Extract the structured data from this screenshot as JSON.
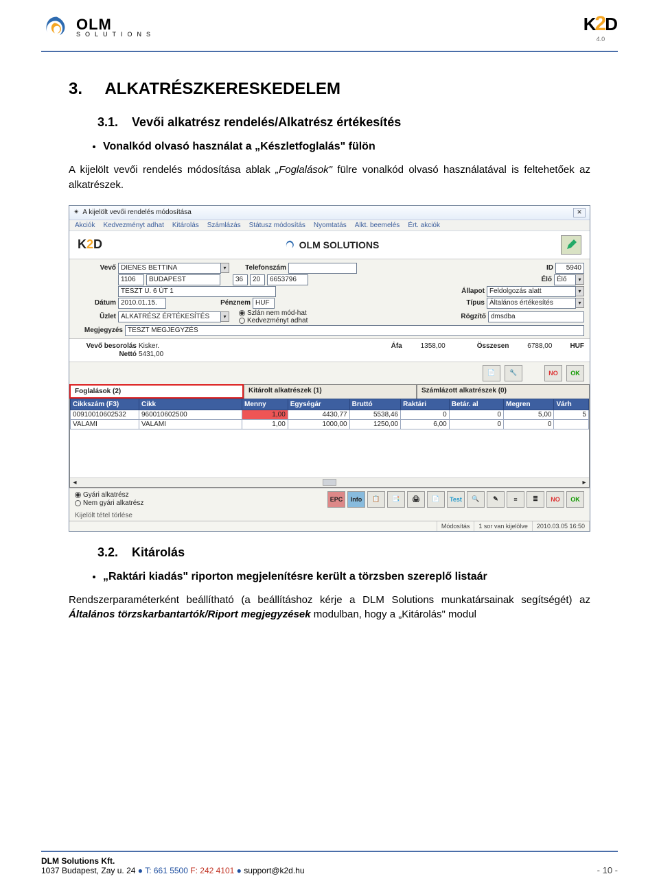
{
  "header": {
    "left_logo_text": "OLM",
    "left_logo_sub": "SOLUTIONS",
    "right_logo_text_k": "K",
    "right_logo_text_num": "2",
    "right_logo_text_d": "D",
    "right_logo_sub": "4.0"
  },
  "doc": {
    "h1_num": "3.",
    "h1_text": "ALKATRÉSZKERESKEDELEM",
    "h2a_num": "3.1.",
    "h2a_text": "Vevői alkatrész rendelés/Alkatrész értékesítés",
    "bullet_a": "Vonalkód olvasó használat a „Készletfoglalás\" fülön",
    "para_a_pre": "A kijelölt vevői rendelés módosítása ablak ",
    "para_a_ital": "„Foglalások\"",
    "para_a_post": " fülre vonalkód olvasó használatával is feltehetőek az alkatrészek.",
    "h2b_num": "3.2.",
    "h2b_text": "Kitárolás",
    "bullet_b": "„Raktári kiadás\" riporton megjelenítésre került a törzsben szereplő listaár",
    "para_b_pre": "Rendszerparaméterként beállítható (a beállításhoz kérje a DLM Solutions munkatársainak segítségét) az ",
    "para_b_ital": "Általános törzskarbantartók/Riport megjegyzések",
    "para_b_post": " modulban, hogy a „Kitárolás\" modul"
  },
  "win": {
    "title": "A kijelölt vevői rendelés módosítása",
    "close": "✕",
    "menu": [
      "Akciók",
      "Kedvezményt adhat",
      "Kitárolás",
      "Számlázás",
      "Státusz módosítás",
      "Nyomtatás",
      "Alkt. beemelés",
      "Ért. akciók"
    ],
    "form": {
      "vevo_label": "Vevő",
      "vevo": "DIENES BETTINA",
      "tel_label": "Telefonszám",
      "id_label": "ID",
      "id": "5940",
      "zip": "1106",
      "city": "BUDAPEST",
      "a": "36",
      "b": "20",
      "phone": "6653796",
      "elo_label": "Élő",
      "elo": "Élő",
      "addr": "TESZT U. 6 ÚT 1",
      "allapot_label": "Állapot",
      "allapot": "Feldolgozás alatt",
      "datum_label": "Dátum",
      "datum": "2010.01.15.",
      "penz_label": "Pénznem",
      "penz": "HUF",
      "tipus_label": "Típus",
      "tipus": "Általános értékesítés",
      "uzlet_label": "Üzlet",
      "uzlet": "ALKATRÉSZ ÉRTÉKESÍTÉS",
      "radio1": "Szlán nem mód-hat",
      "radio2": "Kedvezményt adhat",
      "rogzito_label": "Rögzítő",
      "rogzito": "dmsdba",
      "megj_label": "Megjegyzés",
      "megj": "TESZT MEGJEGYZÉS"
    },
    "totals": {
      "besorolas_label": "Vevő besorolás",
      "besorolas": "Kisker.",
      "afa_label": "Áfa",
      "afa": "1358,00",
      "osszesen_label": "Összesen",
      "osszesen": "6788,00",
      "currency": "HUF",
      "netto_label": "Nettó",
      "netto": "5431,00"
    },
    "tabs": [
      "Foglalások (2)",
      "Kitárolt alkatrészek (1)",
      "Számlázott alkatrészek (0)"
    ],
    "grid": {
      "headers": [
        "Cikkszám (F3)",
        "Cikk",
        "Menny",
        "Egységár",
        "Bruttó",
        "Raktári",
        "Betár. al",
        "Megren",
        "Várh"
      ],
      "rows": [
        {
          "cikkszam": "00910010602532",
          "cikk": "960010602500",
          "menny": "1,00",
          "egysegar": "4430,77",
          "brutto": "5538,46",
          "raktari": "0",
          "betar": "0",
          "megren": "5,00",
          "varh": "5",
          "red": true
        },
        {
          "cikkszam": "VALAMI",
          "cikk": "VALAMI",
          "menny": "1,00",
          "egysegar": "1000,00",
          "brutto": "1250,00",
          "raktari": "6,00",
          "betar": "0",
          "megren": "0",
          "varh": ""
        }
      ]
    },
    "bottom": {
      "radio_gyari": "Gyári alkatrész",
      "radio_nemgyari": "Nem gyári alkatrész",
      "del_hint": "Kijelölt tétel törlése"
    },
    "status": {
      "mode": "Módosítás",
      "rows": "1 sor van kijelölve",
      "ts": "2010.03.05 16:50"
    },
    "no_label": "NO",
    "ok_label": "OK"
  },
  "footer": {
    "company": "DLM Solutions Kft.",
    "addr": "1037 Budapest, Zay u. 24",
    "tel_label": "T:",
    "tel": "661 5500",
    "fax_label": "F:",
    "fax": "242 4101",
    "email": "support@k2d.hu",
    "page": "- 10 -"
  }
}
